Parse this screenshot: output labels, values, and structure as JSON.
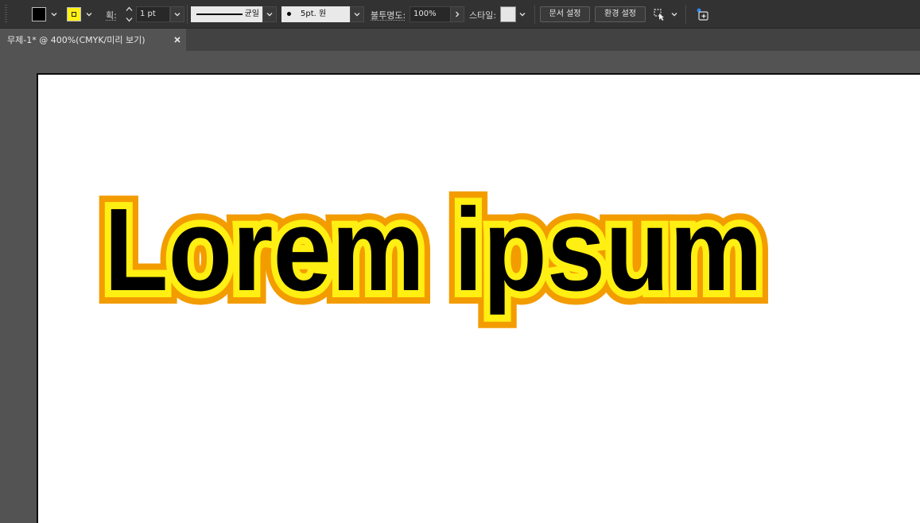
{
  "control_bar": {
    "weight_label": "획:",
    "weight_value": "1 pt",
    "variable_width_profile": "균일",
    "brush_definition": "5pt. 원",
    "opacity_label": "불투명도:",
    "opacity_value": "100%",
    "style_label": "스타일:",
    "document_setup_button": "문서 설정",
    "preferences_button": "환경 설정",
    "fill_color": "#000000",
    "stroke_color": "#FFEF12"
  },
  "document_tab": {
    "label": "무제-1* @ 400%(CMYK/미리 보기)",
    "close_icon": "close-icon"
  },
  "artwork": {
    "text": "Lorem ipsum",
    "fill_color": "#000000",
    "inner_stroke_color": "#FFEF12",
    "outer_stroke_color": "#F39C00"
  }
}
